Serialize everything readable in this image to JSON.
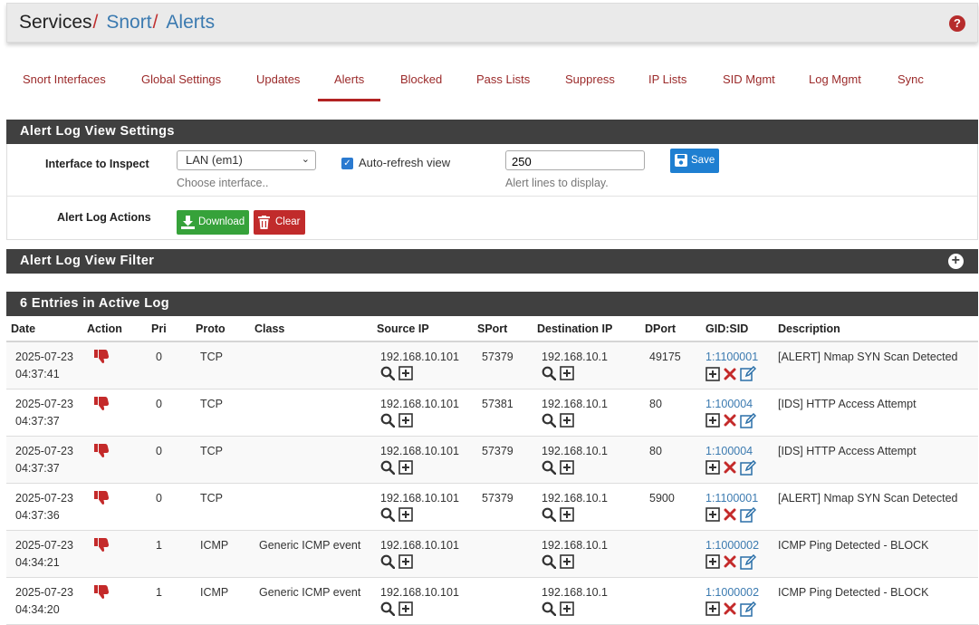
{
  "breadcrumb": {
    "root": "Services",
    "sep": "/",
    "level1": "Snort",
    "level2": "Alerts"
  },
  "help_icon": "?",
  "tabs": [
    {
      "label": "Snort Interfaces"
    },
    {
      "label": "Global Settings"
    },
    {
      "label": "Updates"
    },
    {
      "label": "Alerts",
      "active": true
    },
    {
      "label": "Blocked"
    },
    {
      "label": "Pass Lists"
    },
    {
      "label": "Suppress"
    },
    {
      "label": "IP Lists"
    },
    {
      "label": "SID Mgmt"
    },
    {
      "label": "Log Mgmt"
    },
    {
      "label": "Sync"
    }
  ],
  "settings": {
    "title": "Alert Log View Settings",
    "interface_label": "Interface to Inspect",
    "interface_value": "LAN (em1)",
    "interface_help": "Choose interface..",
    "autorefresh_label": "Auto-refresh view",
    "autorefresh_checked": true,
    "lines_value": "250",
    "lines_help": "Alert lines to display.",
    "save_label": "Save",
    "actions_label": "Alert Log Actions",
    "download_label": "Download",
    "clear_label": "Clear"
  },
  "filter": {
    "title": "Alert Log View Filter"
  },
  "log": {
    "title": "6 Entries in Active Log",
    "columns": [
      "Date",
      "Action",
      "Pri",
      "Proto",
      "Class",
      "Source IP",
      "SPort",
      "Destination IP",
      "DPort",
      "GID:SID",
      "Description"
    ],
    "rows": [
      {
        "date": "2025-07-23",
        "time": "04:37:41",
        "pri": "0",
        "proto": "TCP",
        "class": "",
        "src": "192.168.10.101",
        "sport": "57379",
        "dst": "192.168.10.1",
        "dport": "49175",
        "gidsid": "1:1100001",
        "desc": "[ALERT] Nmap SYN Scan Detected"
      },
      {
        "date": "2025-07-23",
        "time": "04:37:37",
        "pri": "0",
        "proto": "TCP",
        "class": "",
        "src": "192.168.10.101",
        "sport": "57381",
        "dst": "192.168.10.1",
        "dport": "80",
        "gidsid": "1:100004",
        "desc": "[IDS] HTTP Access Attempt"
      },
      {
        "date": "2025-07-23",
        "time": "04:37:37",
        "pri": "0",
        "proto": "TCP",
        "class": "",
        "src": "192.168.10.101",
        "sport": "57379",
        "dst": "192.168.10.1",
        "dport": "80",
        "gidsid": "1:100004",
        "desc": "[IDS] HTTP Access Attempt"
      },
      {
        "date": "2025-07-23",
        "time": "04:37:36",
        "pri": "0",
        "proto": "TCP",
        "class": "",
        "src": "192.168.10.101",
        "sport": "57379",
        "dst": "192.168.10.1",
        "dport": "5900",
        "gidsid": "1:1100001",
        "desc": "[ALERT] Nmap SYN Scan Detected"
      },
      {
        "date": "2025-07-23",
        "time": "04:34:21",
        "pri": "1",
        "proto": "ICMP",
        "class": "Generic ICMP event",
        "src": "192.168.10.101",
        "sport": "",
        "dst": "192.168.10.1",
        "dport": "",
        "gidsid": "1:1000002",
        "desc": "ICMP Ping Detected - BLOCK"
      },
      {
        "date": "2025-07-23",
        "time": "04:34:20",
        "pri": "1",
        "proto": "ICMP",
        "class": "Generic ICMP event",
        "src": "192.168.10.101",
        "sport": "",
        "dst": "192.168.10.1",
        "dport": "",
        "gidsid": "1:1000002",
        "desc": "ICMP Ping Detected - BLOCK"
      }
    ]
  },
  "colors": {
    "accent": "#b22222",
    "link": "#3b7ab0",
    "panel_header": "#404040",
    "save": "#1f7fd1",
    "download": "#36a23a",
    "clear": "#c12b2b"
  }
}
